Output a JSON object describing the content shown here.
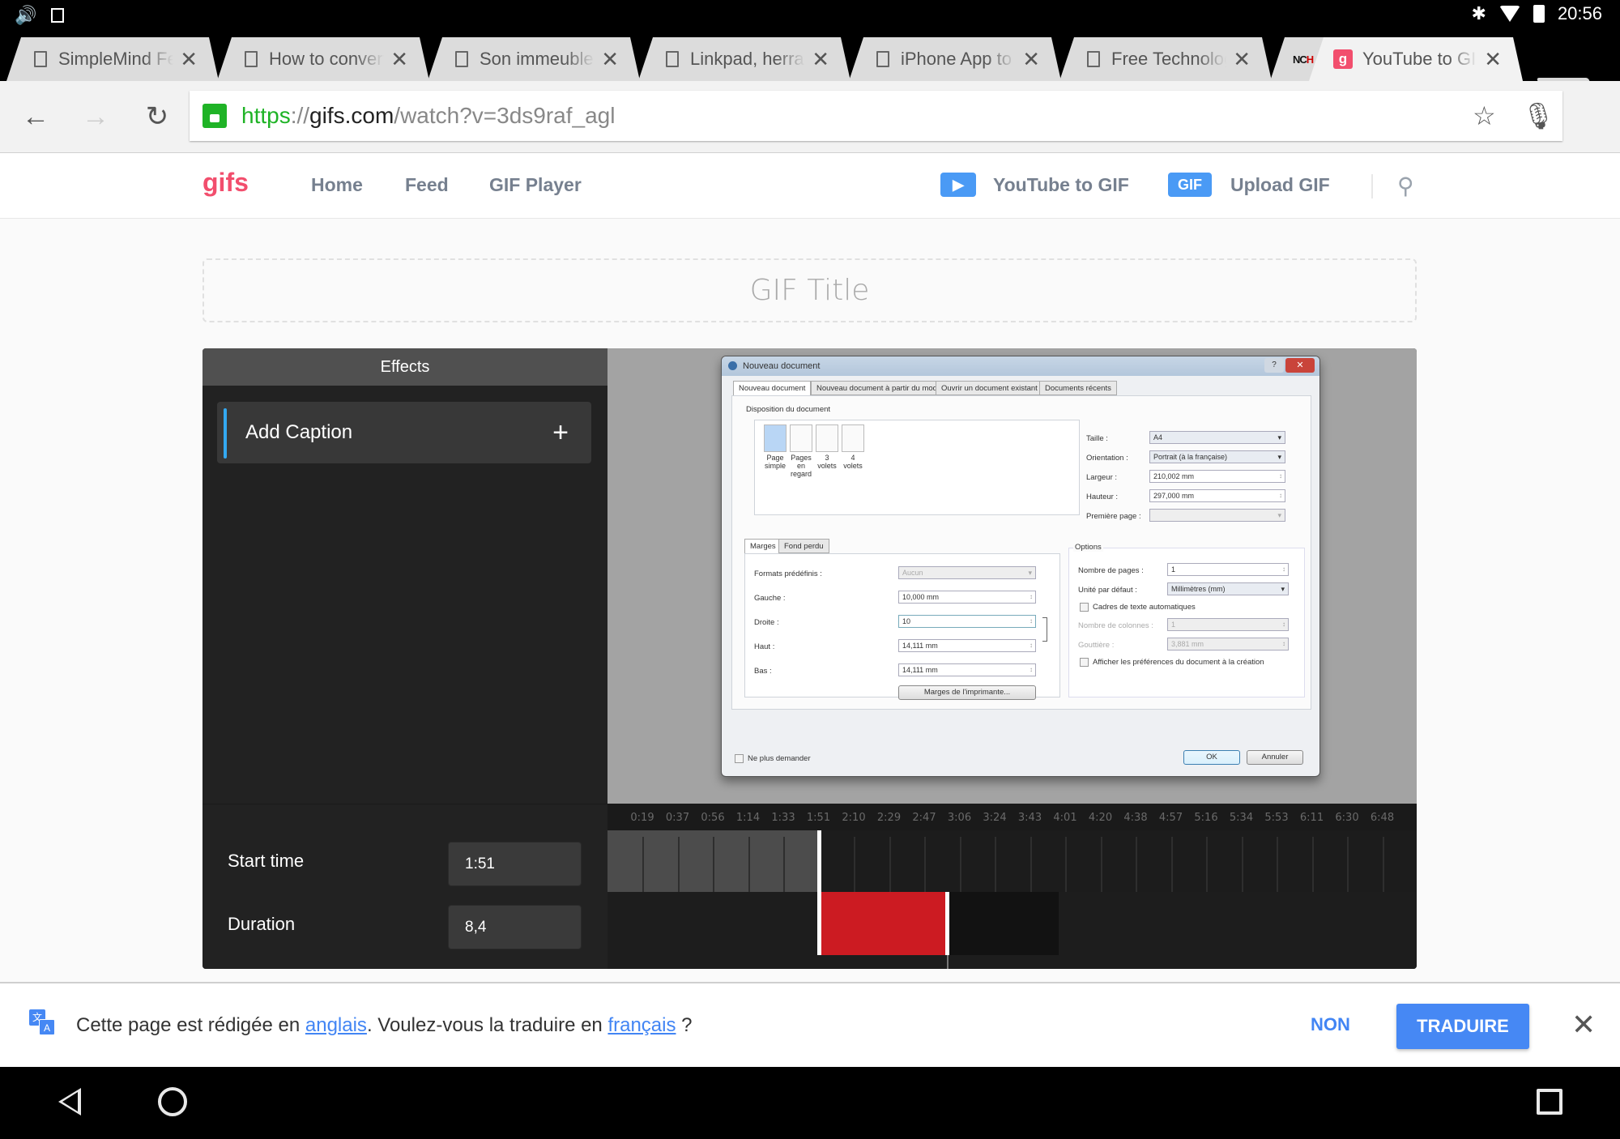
{
  "status_bar": {
    "left_icons": [
      "volume-icon",
      "image-notification-icon"
    ],
    "right_icons": [
      "bluetooth-icon",
      "wifi-icon",
      "battery-icon"
    ],
    "time": "20:56"
  },
  "browser": {
    "tabs": [
      {
        "title": "SimpleMind Features",
        "icon": "page-icon",
        "active": false
      },
      {
        "title": "How to convert t",
        "icon": "page-icon",
        "active": false
      },
      {
        "title": "Son immeuble p",
        "icon": "page-icon",
        "active": false
      },
      {
        "title": "Linkpad, herrami",
        "icon": "page-icon",
        "active": false
      },
      {
        "title": "iPhone App to C",
        "icon": "page-icon",
        "active": false
      },
      {
        "title": "Free Technology",
        "icon": "page-icon",
        "active": false
      },
      {
        "title": "NCH",
        "icon": "nch-favicon",
        "active": false
      },
      {
        "title": "YouTube to GIF |",
        "icon": "gifs-favicon",
        "active": true
      }
    ],
    "url": {
      "scheme": "https",
      "sep": "://",
      "host": "gifs.com",
      "path": "/watch?v=3ds9raf_agl"
    }
  },
  "site_nav": {
    "logo": "gifs",
    "links": [
      "Home",
      "Feed",
      "GIF Player"
    ],
    "youtube_to_gif": "YouTube to GIF",
    "upload_badge": "GIF",
    "upload_gif": "Upload GIF"
  },
  "gif_title": {
    "placeholder": "GIF Title"
  },
  "editor": {
    "effects_header": "Effects",
    "add_caption": "Add Caption",
    "start_time_label": "Start time",
    "start_time_value": "1:51",
    "duration_label": "Duration",
    "duration_value": "8,4",
    "timeline": {
      "labels": [
        "0:19",
        "0:37",
        "0:56",
        "1:14",
        "1:33",
        "1:51",
        "2:10",
        "2:29",
        "2:47",
        "3:06",
        "3:24",
        "3:43",
        "4:01",
        "4:20",
        "4:38",
        "4:57",
        "5:16",
        "5:34",
        "5:53",
        "6:11",
        "6:30",
        "6:48"
      ],
      "start_index": 5,
      "selection_fraction_of_span": 0.4
    }
  },
  "video_frame": {
    "dialog_title": "Nouveau document",
    "tabs": [
      "Nouveau document",
      "Nouveau document à partir du modèle",
      "Ouvrir un document existant",
      "Documents récents"
    ],
    "layout_group": "Disposition du document",
    "page_types": [
      [
        "Page",
        "simple"
      ],
      [
        "Pages",
        "en",
        "regard"
      ],
      [
        "3",
        "volets"
      ],
      [
        "4",
        "volets"
      ]
    ],
    "right_fields": [
      {
        "label": "Taille :",
        "value": "A4",
        "kind": "select"
      },
      {
        "label": "Orientation :",
        "value": "Portrait (à la française)",
        "kind": "select"
      },
      {
        "label": "Largeur :",
        "value": "210,002 mm",
        "kind": "spin"
      },
      {
        "label": "Hauteur :",
        "value": "297,000 mm",
        "kind": "spin"
      },
      {
        "label": "Première page :",
        "value": "",
        "kind": "select-disabled"
      }
    ],
    "margin_tabs": [
      "Marges",
      "Fond perdu"
    ],
    "margin_fields": [
      {
        "label": "Formats prédéfinis :",
        "value": "Aucun",
        "kind": "select-disabled"
      },
      {
        "label": "Gauche :",
        "value": "10,000 mm",
        "kind": "spin"
      },
      {
        "label": "Droite :",
        "value": "10",
        "kind": "spin"
      },
      {
        "label": "Haut :",
        "value": "14,111 mm",
        "kind": "spin"
      },
      {
        "label": "Bas :",
        "value": "14,111 mm",
        "kind": "spin"
      }
    ],
    "printer_margins_button": "Marges de l'imprimante...",
    "options_group": "Options",
    "options": [
      {
        "label": "Nombre de pages :",
        "value": "1",
        "kind": "spin"
      },
      {
        "label": "Unité par défaut :",
        "value": "Millimètres (mm)",
        "kind": "select"
      },
      {
        "label": "Cadres de texte automatiques",
        "kind": "checkbox"
      },
      {
        "label": "Nombre de colonnes :",
        "value": "1",
        "kind": "spin-disabled"
      },
      {
        "label": "Gouttière :",
        "value": "3,881 mm",
        "kind": "spin-disabled"
      },
      {
        "label": "Afficher les préférences du document à la création",
        "kind": "checkbox"
      }
    ],
    "dont_ask": "Ne plus demander",
    "ok": "OK",
    "cancel": "Annuler"
  },
  "translate_bar": {
    "text_before": "Cette page est rédigée en ",
    "source_lang": "anglais",
    "text_middle": ". Voulez-vous la traduire en ",
    "target_lang": "français",
    "text_after": " ?",
    "no_label": "NON",
    "translate_label": "TRADUIRE"
  },
  "colors": {
    "brand": "#f24e6d",
    "accent_blue": "#4a9af5",
    "selection_red": "#cc1b22",
    "translate_blue": "#4688f4",
    "caption_bar": "#33a8f0"
  }
}
